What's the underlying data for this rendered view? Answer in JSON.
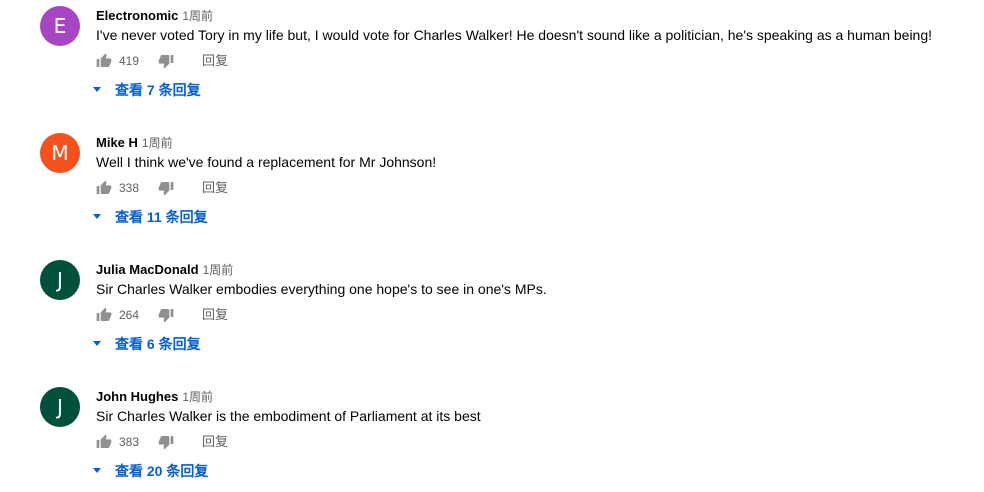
{
  "comments": [
    {
      "author": "Electronomic",
      "time": "1周前",
      "avatar_letter": "E",
      "avatar_color": "#a845c4",
      "text": "I've never voted Tory in my life but, I would vote for Charles Walker! He doesn't sound like a politician, he's speaking as a human being!",
      "likes": "419",
      "reply_label": "回复",
      "view_replies": "查看 7 条回复"
    },
    {
      "author": "Mike H",
      "time": "1周前",
      "avatar_letter": "M",
      "avatar_color": "#f4511e",
      "text": "Well I think we've found a replacement for Mr Johnson!",
      "likes": "338",
      "reply_label": "回复",
      "view_replies": "查看 11 条回复"
    },
    {
      "author": "Julia MacDonald",
      "time": "1周前",
      "avatar_letter": "J",
      "avatar_color": "#00513b",
      "text": "Sir Charles Walker embodies everything one hope's to see in one's MPs.",
      "likes": "264",
      "reply_label": "回复",
      "view_replies": "查看 6 条回复"
    },
    {
      "author": "John Hughes",
      "time": "1周前",
      "avatar_letter": "J",
      "avatar_color": "#00513b",
      "text": "Sir Charles Walker is the embodiment of Parliament at its best",
      "likes": "383",
      "reply_label": "回复",
      "view_replies": "查看 20 条回复"
    }
  ],
  "icons": {
    "like": "thumb-up-icon",
    "dislike": "thumb-down-icon",
    "expand": "caret-down-icon"
  },
  "colors": {
    "link_blue": "#065fd4",
    "secondary_text": "#606060",
    "primary_text": "#030303"
  }
}
